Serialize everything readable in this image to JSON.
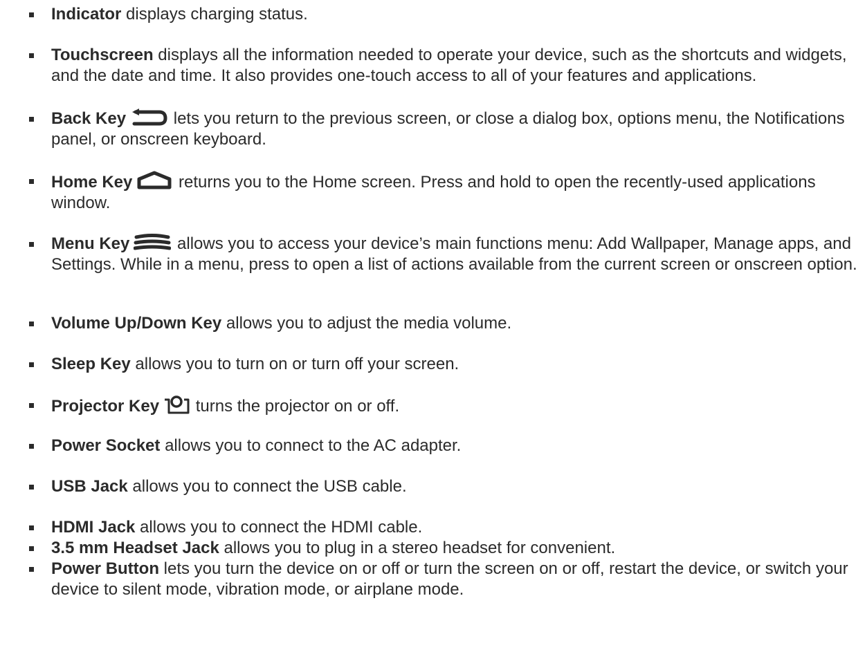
{
  "items": [
    {
      "term": "Indicator",
      "desc": " displays charging status."
    },
    {
      "term": "Touchscreen",
      "desc": " displays all the information needed to operate your device, such as the shortcuts and widgets, and the date and time. It also provides one-touch access to all of your features and applications."
    },
    {
      "term": "Back Key",
      "icon": "back-arrow-icon",
      "desc": " lets you return to the previous screen, or close a dialog box, options menu, the Notifications panel, or onscreen keyboard."
    },
    {
      "term": "Home Key",
      "icon": "home-icon",
      "desc": " returns you to the Home screen. Press and hold to open the recently-used applications window."
    },
    {
      "term": "Menu Key",
      "icon": "menu-icon",
      "desc": " allows you to access your device’s main functions menu: Add Wallpaper, Manage apps, and Settings. While in a menu, press to open a list of actions available from the current screen or onscreen option."
    },
    {
      "term": "Volume Up/Down Key",
      "desc": " allows you to adjust the media volume."
    },
    {
      "term": "Sleep Key",
      "desc": " allows you to turn on or turn off your screen."
    },
    {
      "term": "Projector Key",
      "icon": "projector-icon",
      "desc": " turns the projector on or off."
    },
    {
      "term": "Power Socket",
      "desc": " allows you to connect to the AC adapter."
    },
    {
      "term": "USB Jack",
      "desc": " allows you to connect the USB cable."
    },
    {
      "term": "HDMI Jack",
      "desc": " allows you to connect the HDMI cable."
    },
    {
      "term": "3.5 mm Headset Jack",
      "desc": " allows you to plug in a stereo headset for convenient."
    },
    {
      "term": "Power Button",
      "desc": " lets you turn the device on or off or turn the screen on or off, restart the device, or switch your device to silent mode, vibration mode, or airplane mode."
    }
  ]
}
